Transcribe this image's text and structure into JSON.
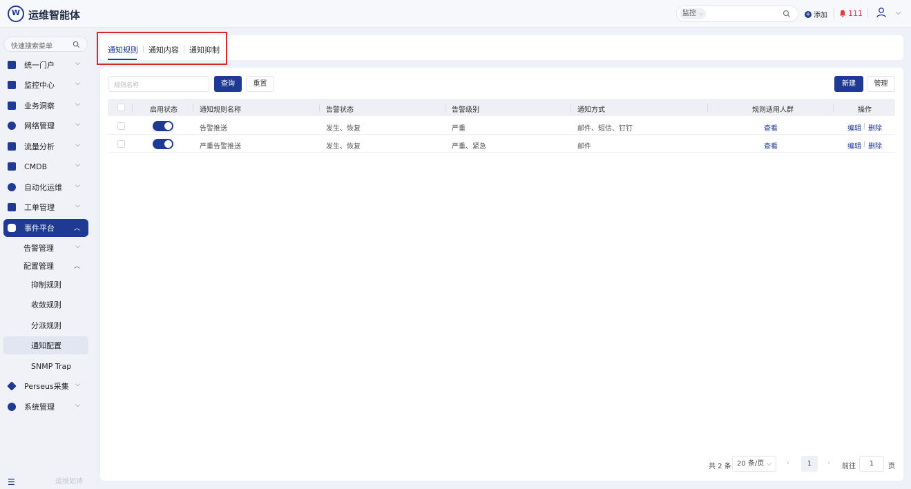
{
  "app": {
    "title": "运维智能体"
  },
  "topbar": {
    "search_select": "监控",
    "add_label": "添加",
    "alert_count": "111"
  },
  "sidebar": {
    "search_placeholder": "快速搜索菜单",
    "items": [
      {
        "label": "统一门户"
      },
      {
        "label": "监控中心"
      },
      {
        "label": "业务洞察"
      },
      {
        "label": "网络管理"
      },
      {
        "label": "流量分析"
      },
      {
        "label": "CMDB"
      },
      {
        "label": "自动化运维"
      },
      {
        "label": "工单管理"
      },
      {
        "label": "事件平台"
      }
    ],
    "sub_items": [
      {
        "label": "告警管理"
      },
      {
        "label": "配置管理"
      }
    ],
    "leaf_items": [
      {
        "label": "抑制规则"
      },
      {
        "label": "收敛规则"
      },
      {
        "label": "分派规则"
      },
      {
        "label": "通知配置"
      },
      {
        "label": "SNMP Trap"
      }
    ],
    "bottom_items": [
      {
        "label": "Perseus采集"
      },
      {
        "label": "系统管理"
      }
    ],
    "footer": "运维如诗"
  },
  "tabs": [
    {
      "label": "通知规则"
    },
    {
      "label": "通知内容"
    },
    {
      "label": "通知抑制"
    }
  ],
  "filter": {
    "placeholder": "规则名称",
    "query_label": "查询",
    "reset_label": "重置",
    "new_label": "新建",
    "manage_label": "管理"
  },
  "table": {
    "headers": [
      "启用状态",
      "通知规则名称",
      "告警状态",
      "告警级别",
      "通知方式",
      "规则适用人群",
      "操作"
    ],
    "rows": [
      {
        "name": "告警推送",
        "alert_status": "发生、恢复",
        "level": "严重",
        "method": "邮件、短信、钉钉",
        "audience": "查看",
        "edit": "编辑",
        "delete": "删除"
      },
      {
        "name": "严重告警推送",
        "alert_status": "发生、恢复",
        "level": "严重、紧急",
        "method": "邮件",
        "audience": "查看",
        "edit": "编辑",
        "delete": "删除"
      }
    ]
  },
  "pagination": {
    "total": "共 2 条",
    "page_size": "20 条/页",
    "current": "1",
    "goto_label": "前往",
    "goto_value": "1",
    "page_unit": "页"
  },
  "colors": {
    "primary": "#1f3a93",
    "highlight": "#d62828",
    "alert": "#e23c3c"
  }
}
